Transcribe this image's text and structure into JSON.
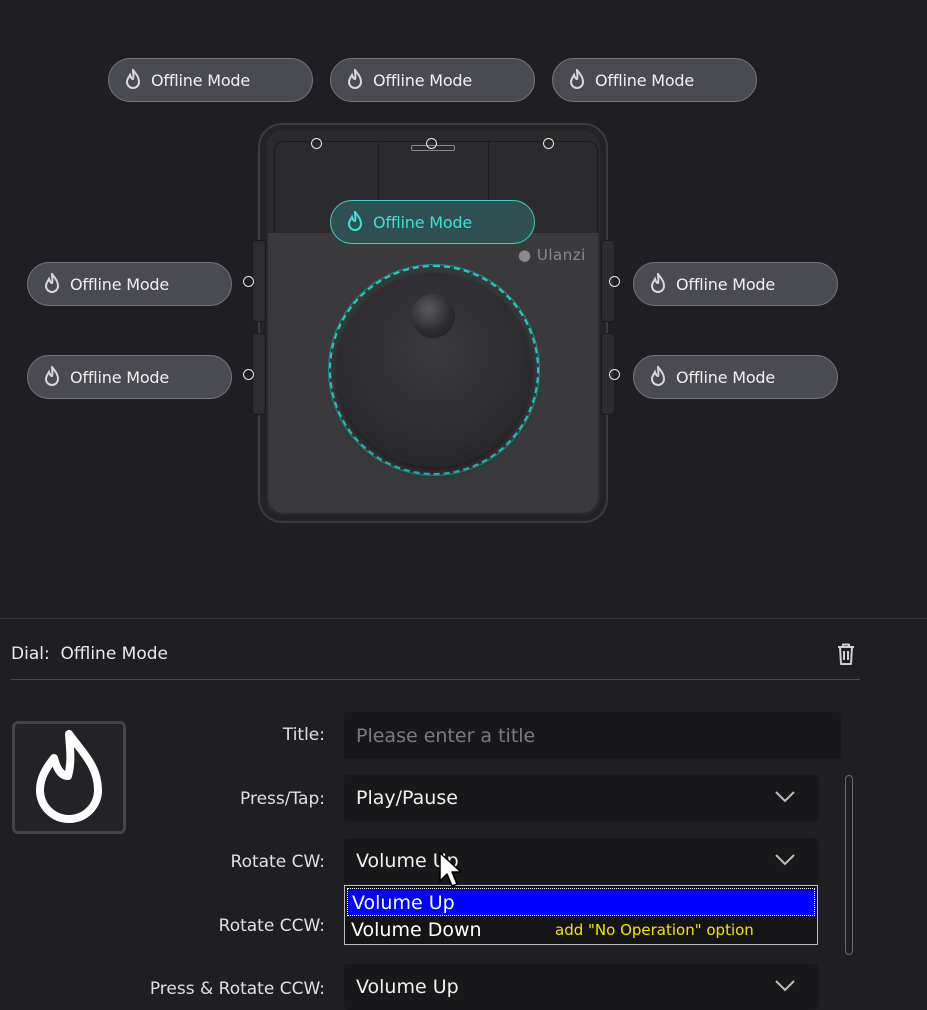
{
  "buttons": {
    "top_left": "Offline Mode",
    "top_middle": "Offline Mode",
    "top_right": "Offline Mode",
    "dial": "Offline Mode",
    "left_upper": "Offline Mode",
    "left_lower": "Offline Mode",
    "right_upper": "Offline Mode",
    "right_lower": "Offline Mode"
  },
  "device": {
    "brand": "Ulanzi",
    "accent": "#28d0c8"
  },
  "icons": {
    "button_icon": "flame-icon",
    "delete": "trash-icon",
    "dropdown": "chevron-down-icon"
  },
  "settings": {
    "header_prefix": "Dial:",
    "header_name": "Offline Mode",
    "title_label": "Title",
    "title_placeholder": "Please enter a title",
    "title_value": "",
    "press_label": "Press/Tap",
    "press_value": "Play/Pause",
    "rotate_cw_label": "Rotate CW",
    "rotate_cw_value": "Volume Up",
    "rotate_ccw_label": "Rotate CCW",
    "press_rotate_ccw_label": "Press & Rotate CCW",
    "press_rotate_ccw_value": "Volume Up"
  },
  "dropdown": {
    "options": [
      "Volume Up",
      "Volume Down"
    ],
    "selected": "Volume Up",
    "note": "add \"No Operation\" option"
  }
}
